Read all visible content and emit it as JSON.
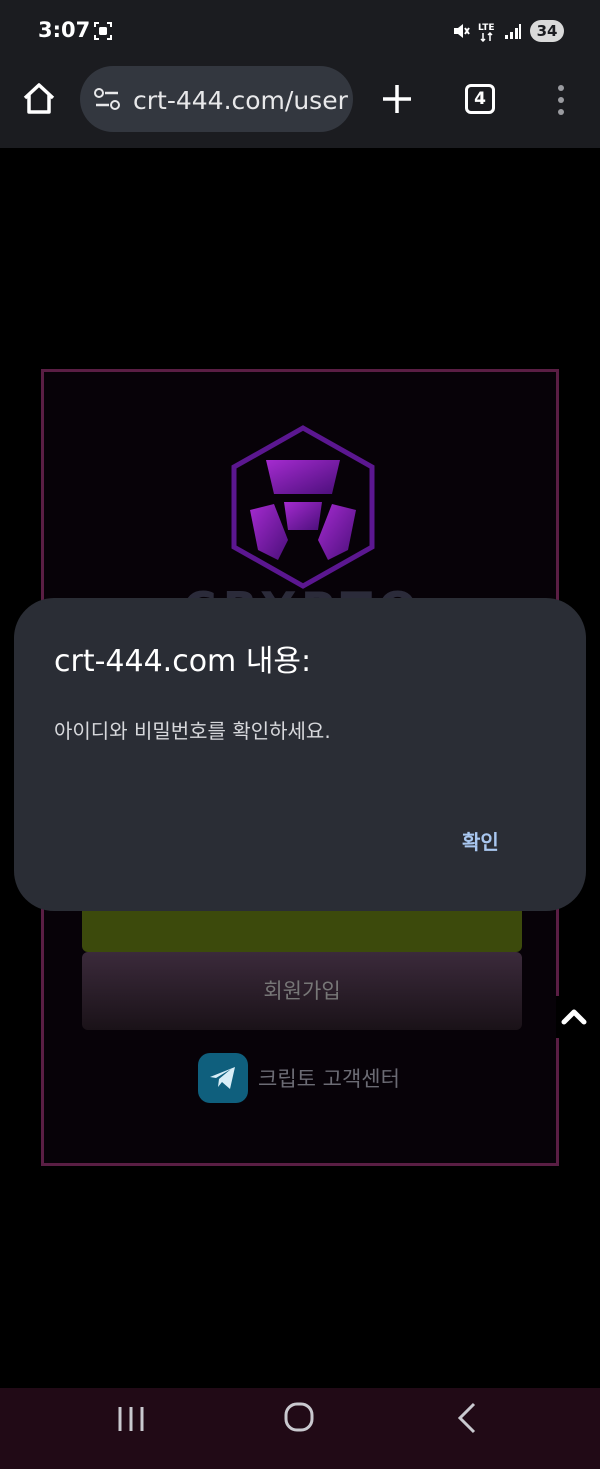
{
  "status_bar": {
    "time": "3:07",
    "battery": "34",
    "icons": [
      "screenshot-icon",
      "mute-icon",
      "lte-icon",
      "signal-icon"
    ]
  },
  "browser": {
    "url": "crt-444.com/user",
    "tab_count": "4",
    "icons": [
      "home-icon",
      "site-info-icon",
      "new-tab-icon",
      "more-menu-icon"
    ]
  },
  "page": {
    "brand": "CRYPTO",
    "signup_label": "회원가입",
    "support_label": "크립토 고객센터"
  },
  "dialog": {
    "title": "crt-444.com 내용:",
    "message": "아이디와 비밀번호를 확인하세요.",
    "ok_label": "확인"
  },
  "colors": {
    "background": "#000000",
    "dialog_bg": "#2a2d35",
    "accent_link": "#a9c7f0",
    "card_border": "#5a1e44",
    "logo_purple": "#6a1a9a",
    "login_button": "#3c4a0c"
  }
}
